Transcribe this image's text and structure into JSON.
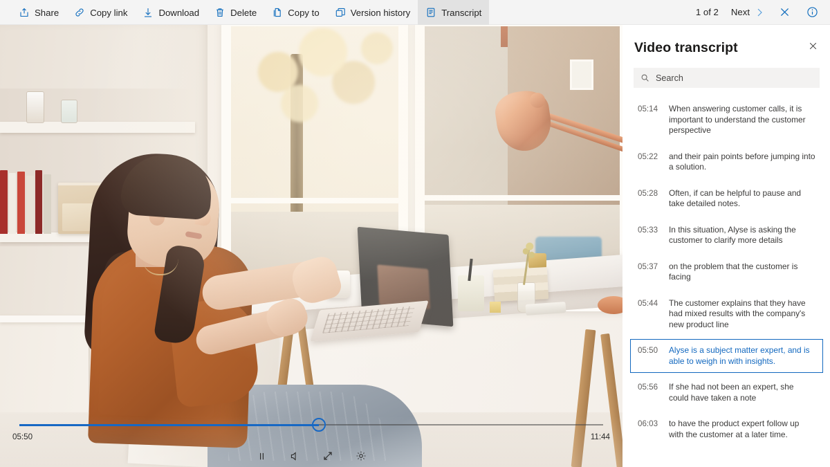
{
  "toolbar": {
    "actions": [
      {
        "label": "Share",
        "icon": "share-icon"
      },
      {
        "label": "Copy link",
        "icon": "link-icon"
      },
      {
        "label": "Download",
        "icon": "download-icon"
      },
      {
        "label": "Delete",
        "icon": "trash-icon"
      },
      {
        "label": "Copy to",
        "icon": "copy-icon"
      },
      {
        "label": "Version history",
        "icon": "history-icon"
      },
      {
        "label": "Transcript",
        "icon": "transcript-icon"
      }
    ],
    "active_action": "Transcript",
    "pager_text": "1 of 2",
    "next_label": "Next",
    "close_icon": "close-icon",
    "info_icon": "info-icon",
    "accent_color": "#0f6cbd",
    "background_color": "#f4f4f4"
  },
  "player": {
    "current_time": "05:50",
    "total_time": "11:44",
    "progress_percent": 49.6,
    "accent_color": "#1768c4",
    "controls": [
      {
        "name": "pause-button",
        "icon": "pause-icon"
      },
      {
        "name": "volume-button",
        "icon": "volume-icon"
      },
      {
        "name": "fullscreen-button",
        "icon": "expand-icon"
      },
      {
        "name": "settings-button",
        "icon": "gear-icon"
      }
    ]
  },
  "panel": {
    "title": "Video transcript",
    "close_icon": "close-icon",
    "search": {
      "placeholder": "Search",
      "icon": "search-icon"
    },
    "selected_timestamp": "05:50",
    "selected_color": "#1268bf",
    "entries": [
      {
        "time": "05:14",
        "text": "When answering customer calls, it is important to understand the customer perspective",
        "selected": false
      },
      {
        "time": "05:22",
        "text": "and their pain points before jumping into a solution.",
        "selected": false
      },
      {
        "time": "05:28",
        "text": "Often, if can be helpful to pause and take detailed notes.",
        "selected": false
      },
      {
        "time": "05:33",
        "text": "In this situation, Alyse is asking the customer to clarify more details",
        "selected": false
      },
      {
        "time": "05:37",
        "text": "on the problem that the customer is facing",
        "selected": false
      },
      {
        "time": "05:44",
        "text": "The customer explains that they have had mixed results with the company's new product line",
        "selected": false
      },
      {
        "time": "05:50",
        "text": "Alyse is a subject matter expert, and is able to weigh in with insights.",
        "selected": true
      },
      {
        "time": "05:56",
        "text": "If she had not been an expert, she could have taken a note",
        "selected": false
      },
      {
        "time": "06:03",
        "text": "to have the product expert follow up with the customer at a later time.",
        "selected": false
      }
    ]
  }
}
